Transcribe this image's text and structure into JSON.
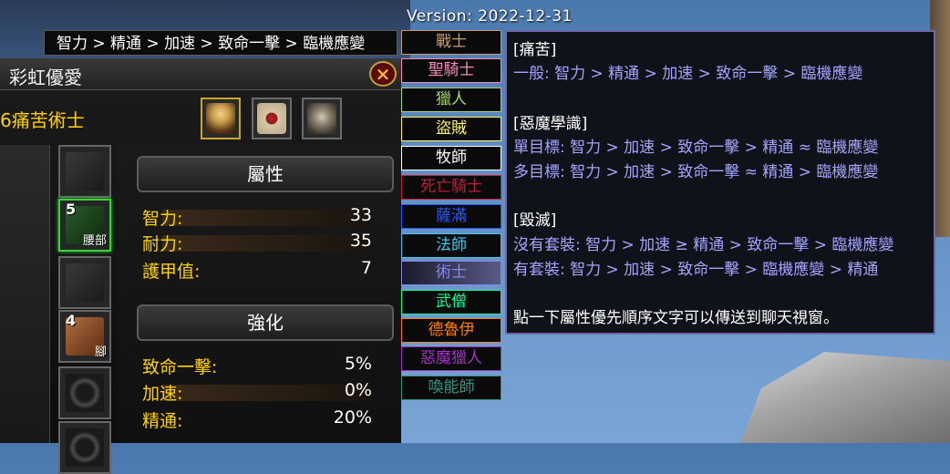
{
  "version": "Version: 2022-12-31",
  "priority_bar": "智力 > 精通 > 加速 > 致命一擊 > 臨機應變",
  "character": {
    "name": "彩虹優愛",
    "spec": "6痛苦術士",
    "close_label": "✕"
  },
  "slots": [
    {
      "num": "",
      "label": ""
    },
    {
      "num": "5",
      "label": "腰部"
    },
    {
      "num": "",
      "label": ""
    },
    {
      "num": "4",
      "label": "腳"
    },
    {
      "num": "",
      "label": ""
    },
    {
      "num": "",
      "label": ""
    }
  ],
  "attributes": {
    "header": "屬性",
    "rows": [
      {
        "label": "智力:",
        "value": "33"
      },
      {
        "label": "耐力:",
        "value": "35"
      },
      {
        "label": "護甲值:",
        "value": "7"
      }
    ]
  },
  "enhancements": {
    "header": "強化",
    "rows": [
      {
        "label": "致命一擊:",
        "value": "5%"
      },
      {
        "label": "加速:",
        "value": "0%"
      },
      {
        "label": "精通:",
        "value": "20%"
      }
    ]
  },
  "classes": [
    {
      "name": "戰士",
      "color": "#c69b6d"
    },
    {
      "name": "聖騎士",
      "color": "#f48cba"
    },
    {
      "name": "獵人",
      "color": "#aad372"
    },
    {
      "name": "盜賊",
      "color": "#fff468"
    },
    {
      "name": "牧師",
      "color": "#ffffff"
    },
    {
      "name": "死亡騎士",
      "color": "#c41e3a"
    },
    {
      "name": "薩滿",
      "color": "#2459ff"
    },
    {
      "name": "法師",
      "color": "#3fc7eb"
    },
    {
      "name": "術士",
      "color": "#8788ee"
    },
    {
      "name": "武僧",
      "color": "#00ff98"
    },
    {
      "name": "德魯伊",
      "color": "#ff7c0a"
    },
    {
      "name": "惡魔獵人",
      "color": "#a330c9"
    },
    {
      "name": "喚能師",
      "color": "#33937f"
    }
  ],
  "info": {
    "l1": "[痛苦]",
    "l2": "一般: 智力 > 精通 > 加速 > 致命一擊 > 臨機應變",
    "l3": "[惡魔學識]",
    "l4": "單目標: 智力 > 加速 > 致命一擊 > 精通 ≈ 臨機應變",
    "l5": "多目標: 智力 > 加速 > 致命一擊 ≈ 精通 > 臨機應變",
    "l6": "[毀滅]",
    "l7": "沒有套裝: 智力 > 加速 ≥ 精通 > 致命一擊 > 臨機應變",
    "l8": "有套裝: 智力 > 加速 > 致命一擊 > 臨機應變 > 精通",
    "l9": "點一下屬性優先順序文字可以傳送到聊天視窗。"
  }
}
